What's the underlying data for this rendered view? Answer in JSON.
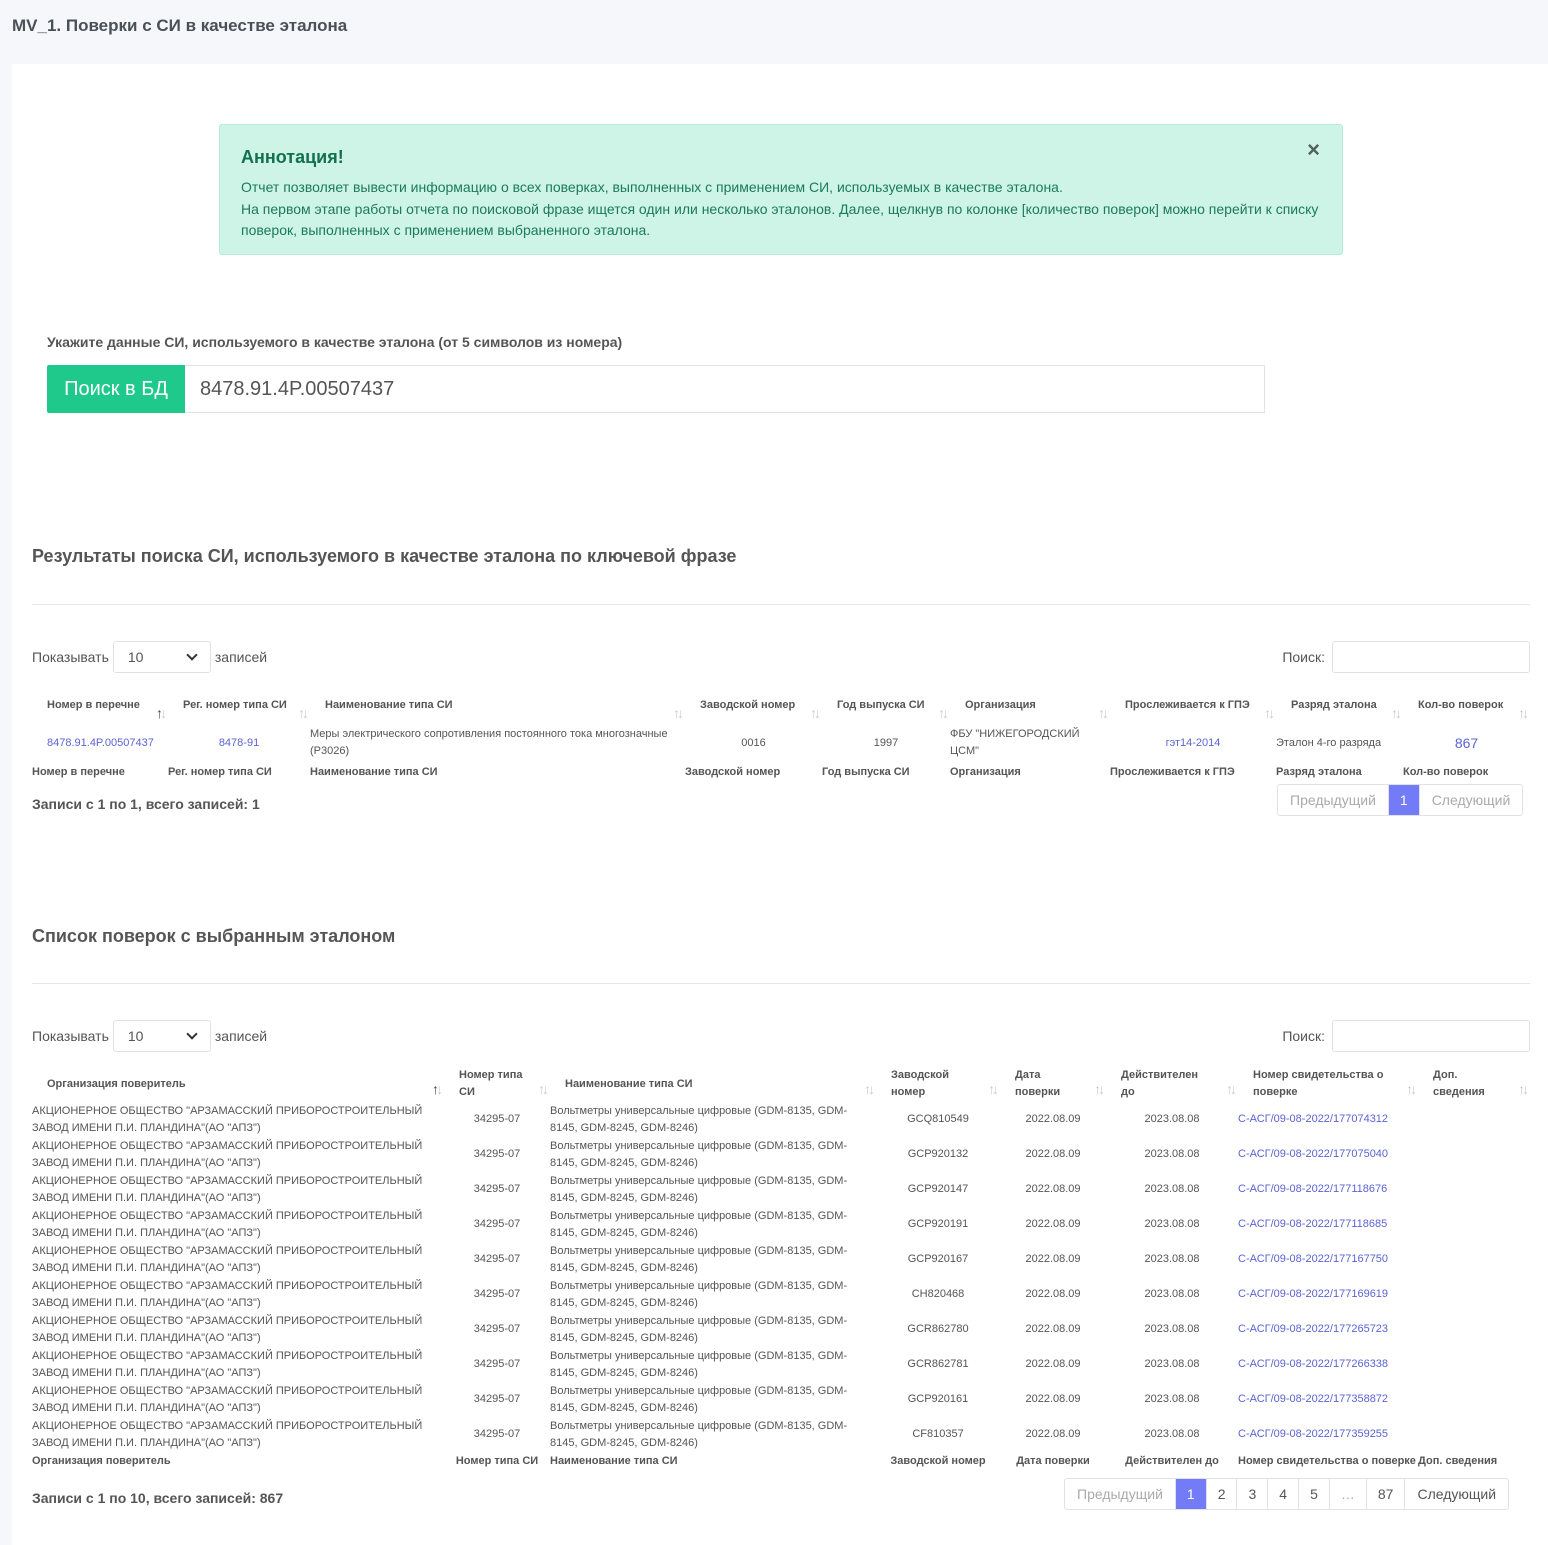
{
  "page_title": "MV_1. Поверки с СИ в качестве эталона",
  "alert": {
    "title": "Аннотация!",
    "line1": "Отчет позволяет вывести информацию о всех поверках, выполненных с применением СИ, используемых в качестве эталона.",
    "line2": "На первом этапе работы отчета по поисковой фразе ищется один или несколько эталонов. Далее, щелкнув по колонке [количество поверок] можно перейти к списку поверок, выполненных с применением выбраненного эталона.",
    "close": "×"
  },
  "search": {
    "label": "Укажите данные СИ, используемого в качестве эталона (от 5 символов из номера)",
    "button": "Поиск в БД",
    "value": "8478.91.4P.00507437"
  },
  "results": {
    "title": "Результаты поиска СИ, используемого в качестве эталона по ключевой фразе",
    "show_label": "Показывать",
    "show_value": "10",
    "records_label": "записей",
    "search_label": "Поиск:",
    "headers": [
      "Номер в перечне",
      "Рег. номер типа СИ",
      "Наименование типа СИ",
      "Заводской номер",
      "Год выпуска СИ",
      "Организация",
      "Прослеживается к ГПЭ",
      "Разряд эталона",
      "Кол-во поверок"
    ],
    "rows": [
      {
        "num": "8478.91.4P.00507437",
        "reg": "8478-91",
        "name": "Меры электрического сопротивления постоянного тока многозначные (Р3026)",
        "serial": "0016",
        "year": "1997",
        "org": "ФБУ \"НИЖЕГОРОДСКИЙ ЦСМ\"",
        "gpe": "гэт14-2014",
        "rank": "Эталон 4-го разряда",
        "count": "867"
      }
    ],
    "info": "Записи с 1 по 1, всего записей: 1",
    "pager": [
      "Предыдущий",
      "1",
      "Следующий"
    ]
  },
  "verifications": {
    "title": "Список поверок с выбранным эталоном",
    "show_label": "Показывать",
    "show_value": "10",
    "records_label": "записей",
    "search_label": "Поиск:",
    "headers": [
      "Организация поверитель",
      "Номер типа СИ",
      "Наименование типа СИ",
      "Заводской номер",
      "Дата поверки",
      "Действителен до",
      "Номер свидетельства о поверке",
      "Доп. сведения"
    ],
    "rows": [
      {
        "org": "АКЦИОНЕРНОЕ ОБЩЕСТВО \"АРЗАМАССКИЙ ПРИБОРОСТРОИТЕЛЬНЫЙ ЗАВОД ИМЕНИ П.И. ПЛАНДИНА\"(АО \"АПЗ\")",
        "type": "34295-07",
        "name": "Вольтметры универсальные цифровые (GDM-8135, GDM-8145, GDM-8245, GDM-8246)",
        "serial": "GCQ810549",
        "date": "2022.08.09",
        "valid": "2023.08.08",
        "cert": "С-АСГ/09-08-2022/177074312",
        "extra": ""
      },
      {
        "org": "АКЦИОНЕРНОЕ ОБЩЕСТВО \"АРЗАМАССКИЙ ПРИБОРОСТРОИТЕЛЬНЫЙ ЗАВОД ИМЕНИ П.И. ПЛАНДИНА\"(АО \"АПЗ\")",
        "type": "34295-07",
        "name": "Вольтметры универсальные цифровые (GDM-8135, GDM-8145, GDM-8245, GDM-8246)",
        "serial": "GCP920132",
        "date": "2022.08.09",
        "valid": "2023.08.08",
        "cert": "С-АСГ/09-08-2022/177075040",
        "extra": ""
      },
      {
        "org": "АКЦИОНЕРНОЕ ОБЩЕСТВО \"АРЗАМАССКИЙ ПРИБОРОСТРОИТЕЛЬНЫЙ ЗАВОД ИМЕНИ П.И. ПЛАНДИНА\"(АО \"АПЗ\")",
        "type": "34295-07",
        "name": "Вольтметры универсальные цифровые (GDM-8135, GDM-8145, GDM-8245, GDM-8246)",
        "serial": "GCP920147",
        "date": "2022.08.09",
        "valid": "2023.08.08",
        "cert": "С-АСГ/09-08-2022/177118676",
        "extra": ""
      },
      {
        "org": "АКЦИОНЕРНОЕ ОБЩЕСТВО \"АРЗАМАССКИЙ ПРИБОРОСТРОИТЕЛЬНЫЙ ЗАВОД ИМЕНИ П.И. ПЛАНДИНА\"(АО \"АПЗ\")",
        "type": "34295-07",
        "name": "Вольтметры универсальные цифровые (GDM-8135, GDM-8145, GDM-8245, GDM-8246)",
        "serial": "GCP920191",
        "date": "2022.08.09",
        "valid": "2023.08.08",
        "cert": "С-АСГ/09-08-2022/177118685",
        "extra": ""
      },
      {
        "org": "АКЦИОНЕРНОЕ ОБЩЕСТВО \"АРЗАМАССКИЙ ПРИБОРОСТРОИТЕЛЬНЫЙ ЗАВОД ИМЕНИ П.И. ПЛАНДИНА\"(АО \"АПЗ\")",
        "type": "34295-07",
        "name": "Вольтметры универсальные цифровые (GDM-8135, GDM-8145, GDM-8245, GDM-8246)",
        "serial": "GCP920167",
        "date": "2022.08.09",
        "valid": "2023.08.08",
        "cert": "С-АСГ/09-08-2022/177167750",
        "extra": ""
      },
      {
        "org": "АКЦИОНЕРНОЕ ОБЩЕСТВО \"АРЗАМАССКИЙ ПРИБОРОСТРОИТЕЛЬНЫЙ ЗАВОД ИМЕНИ П.И. ПЛАНДИНА\"(АО \"АПЗ\")",
        "type": "34295-07",
        "name": "Вольтметры универсальные цифровые (GDM-8135, GDM-8145, GDM-8245, GDM-8246)",
        "serial": "CH820468",
        "date": "2022.08.09",
        "valid": "2023.08.08",
        "cert": "С-АСГ/09-08-2022/177169619",
        "extra": ""
      },
      {
        "org": "АКЦИОНЕРНОЕ ОБЩЕСТВО \"АРЗАМАССКИЙ ПРИБОРОСТРОИТЕЛЬНЫЙ ЗАВОД ИМЕНИ П.И. ПЛАНДИНА\"(АО \"АПЗ\")",
        "type": "34295-07",
        "name": "Вольтметры универсальные цифровые (GDM-8135, GDM-8145, GDM-8245, GDM-8246)",
        "serial": "GCR862780",
        "date": "2022.08.09",
        "valid": "2023.08.08",
        "cert": "С-АСГ/09-08-2022/177265723",
        "extra": ""
      },
      {
        "org": "АКЦИОНЕРНОЕ ОБЩЕСТВО \"АРЗАМАССКИЙ ПРИБОРОСТРОИТЕЛЬНЫЙ ЗАВОД ИМЕНИ П.И. ПЛАНДИНА\"(АО \"АПЗ\")",
        "type": "34295-07",
        "name": "Вольтметры универсальные цифровые (GDM-8135, GDM-8145, GDM-8245, GDM-8246)",
        "serial": "GCR862781",
        "date": "2022.08.09",
        "valid": "2023.08.08",
        "cert": "С-АСГ/09-08-2022/177266338",
        "extra": ""
      },
      {
        "org": "АКЦИОНЕРНОЕ ОБЩЕСТВО \"АРЗАМАССКИЙ ПРИБОРОСТРОИТЕЛЬНЫЙ ЗАВОД ИМЕНИ П.И. ПЛАНДИНА\"(АО \"АПЗ\")",
        "type": "34295-07",
        "name": "Вольтметры универсальные цифровые (GDM-8135, GDM-8145, GDM-8245, GDM-8246)",
        "serial": "GCP920161",
        "date": "2022.08.09",
        "valid": "2023.08.08",
        "cert": "С-АСГ/09-08-2022/177358872",
        "extra": ""
      },
      {
        "org": "АКЦИОНЕРНОЕ ОБЩЕСТВО \"АРЗАМАССКИЙ ПРИБОРОСТРОИТЕЛЬНЫЙ ЗАВОД ИМЕНИ П.И. ПЛАНДИНА\"(АО \"АПЗ\")",
        "type": "34295-07",
        "name": "Вольтметры универсальные цифровые (GDM-8135, GDM-8145, GDM-8245, GDM-8246)",
        "serial": "CF810357",
        "date": "2022.08.09",
        "valid": "2023.08.08",
        "cert": "С-АСГ/09-08-2022/177359255",
        "extra": ""
      }
    ],
    "info": "Записи с 1 по 10, всего записей: 867",
    "pager": [
      "Предыдущий",
      "1",
      "2",
      "3",
      "4",
      "5",
      "…",
      "87",
      "Следующий"
    ]
  }
}
